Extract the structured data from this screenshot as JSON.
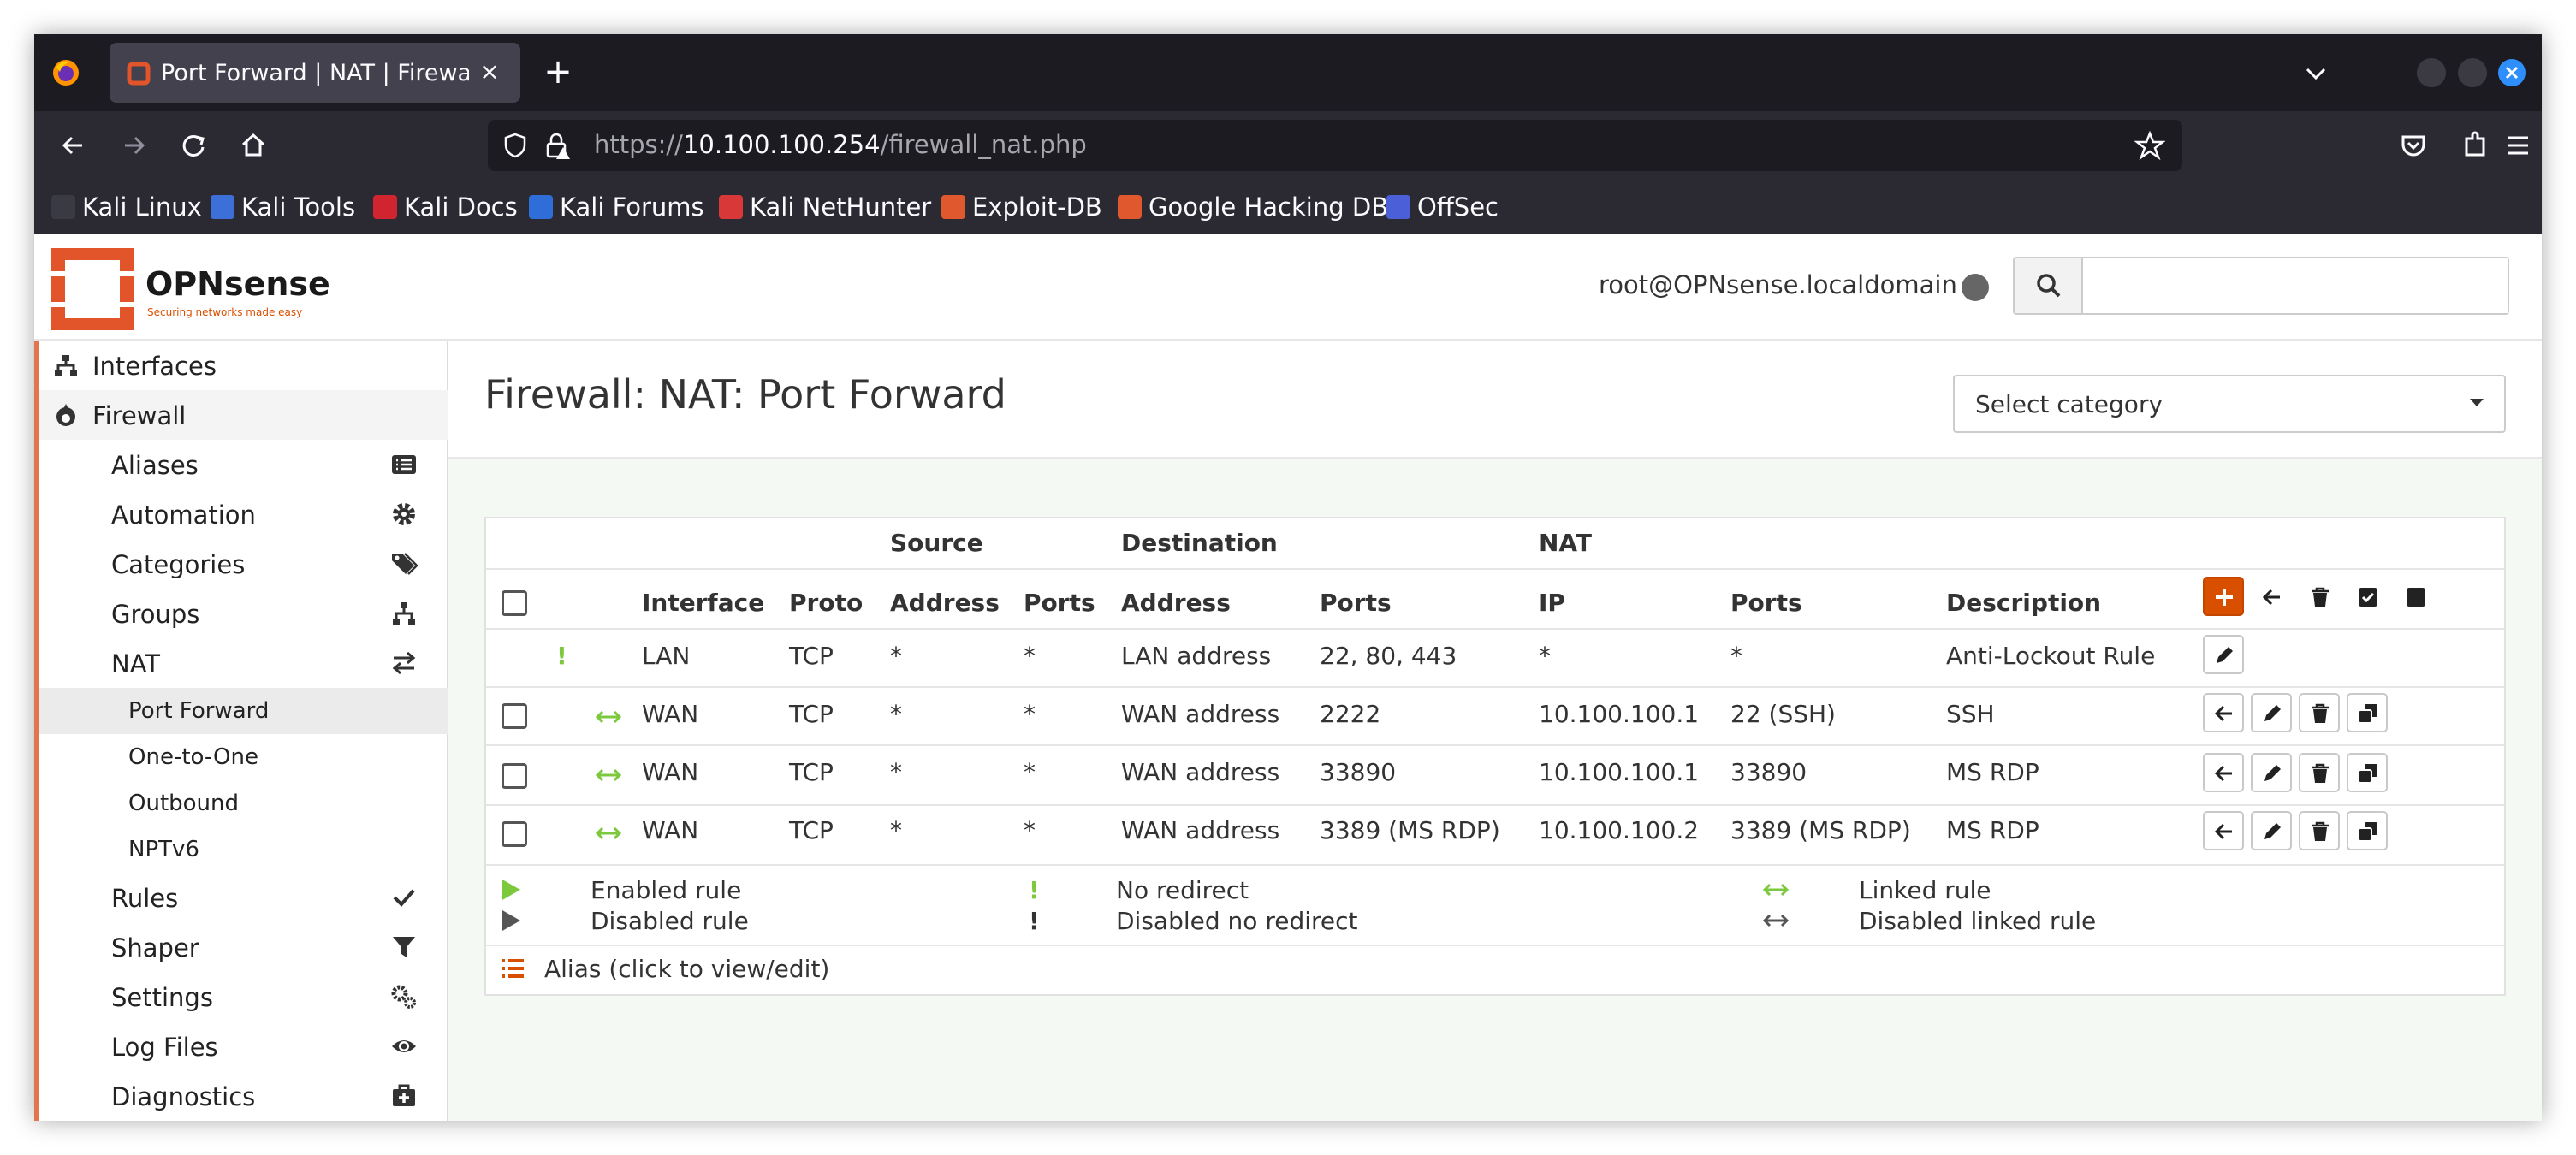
{
  "browser": {
    "tab_title": "Port Forward | NAT | Firewall",
    "url_scheme": "https://",
    "url_host": "10.100.100.254",
    "url_path": "/firewall_nat.php",
    "bookmarks": [
      "Kali Linux",
      "Kali Tools",
      "Kali Docs",
      "Kali Forums",
      "Kali NetHunter",
      "Exploit-DB",
      "Google Hacking DB",
      "OffSec"
    ]
  },
  "header": {
    "logo_text": "OPNsense",
    "logo_tagline": "Securing networks made easy",
    "user": "root@OPNsense.localdomain",
    "search_placeholder": ""
  },
  "sidebar": {
    "items": [
      {
        "label": "Interfaces",
        "icon": "sitemap-icon"
      },
      {
        "label": "Firewall",
        "icon": "fire-icon"
      }
    ],
    "firewall_sub": [
      {
        "label": "Aliases",
        "icon": "list-icon"
      },
      {
        "label": "Automation",
        "icon": "gear-icon"
      },
      {
        "label": "Categories",
        "icon": "tags-icon"
      },
      {
        "label": "Groups",
        "icon": "sitemap-icon"
      },
      {
        "label": "NAT",
        "icon": "exchange-icon"
      },
      {
        "label": "Rules",
        "icon": "check-icon"
      },
      {
        "label": "Shaper",
        "icon": "filter-icon"
      },
      {
        "label": "Settings",
        "icon": "gears-icon"
      },
      {
        "label": "Log Files",
        "icon": "eye-icon"
      },
      {
        "label": "Diagnostics",
        "icon": "medkit-icon"
      }
    ],
    "nat_sub": [
      "Port Forward",
      "One-to-One",
      "Outbound",
      "NPTv6"
    ]
  },
  "page": {
    "title": "Firewall: NAT: Port Forward",
    "category_select": "Select category"
  },
  "table": {
    "group_headers": {
      "source": "Source",
      "destination": "Destination",
      "nat": "NAT"
    },
    "columns": [
      "Interface",
      "Proto",
      "Address",
      "Ports",
      "Address",
      "Ports",
      "IP",
      "Ports",
      "Description"
    ],
    "rows": [
      {
        "marker": "!",
        "interface": "LAN",
        "proto": "TCP",
        "src_addr": "*",
        "src_ports": "*",
        "dst_addr": "LAN address",
        "dst_ports": "22, 80, 443",
        "nat_ip": "*",
        "nat_ports": "*",
        "description": "Anti-Lockout Rule"
      },
      {
        "marker": "↔",
        "interface": "WAN",
        "proto": "TCP",
        "src_addr": "*",
        "src_ports": "*",
        "dst_addr": "WAN address",
        "dst_ports": "2222",
        "nat_ip": "10.100.100.1",
        "nat_ports": "22 (SSH)",
        "description": "SSH"
      },
      {
        "marker": "↔",
        "interface": "WAN",
        "proto": "TCP",
        "src_addr": "*",
        "src_ports": "*",
        "dst_addr": "WAN address",
        "dst_ports": "33890",
        "nat_ip": "10.100.100.1",
        "nat_ports": "33890",
        "description": "MS RDP"
      },
      {
        "marker": "↔",
        "interface": "WAN",
        "proto": "TCP",
        "src_addr": "*",
        "src_ports": "*",
        "dst_addr": "WAN address",
        "dst_ports": "3389 (MS RDP)",
        "nat_ip": "10.100.100.2",
        "nat_ports": "3389 (MS RDP)",
        "description": "MS RDP"
      }
    ]
  },
  "legend": {
    "enabled_rule": "Enabled rule",
    "disabled_rule": "Disabled rule",
    "no_redirect": "No redirect",
    "disabled_no_redirect": "Disabled no redirect",
    "linked_rule": "Linked rule",
    "disabled_linked_rule": "Disabled linked rule",
    "alias_note": "Alias (click to view/edit)"
  },
  "colors": {
    "accent": "#d94f00",
    "enabled_green": "#7cc93e",
    "browser_dark": "#1c1b22"
  }
}
